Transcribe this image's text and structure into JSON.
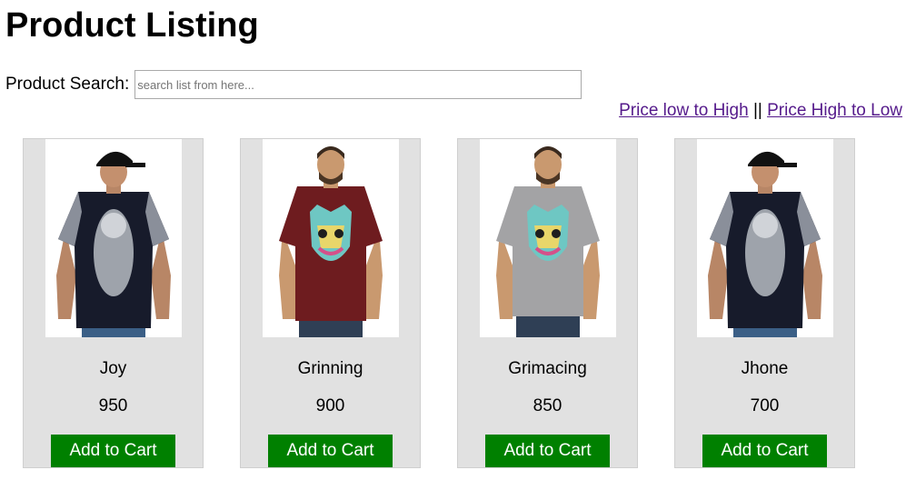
{
  "page": {
    "title": "Product Listing"
  },
  "search": {
    "label": "Product Search:",
    "placeholder": "search list from here...",
    "value": ""
  },
  "sort": {
    "low_to_high": "Price low to High",
    "separator": "||",
    "high_to_low": "Price High to Low",
    "link_color": "#551a8b"
  },
  "colors": {
    "card_background": "#e1e1e1",
    "button_background": "#008000",
    "button_text": "#ffffff"
  },
  "products": [
    {
      "name": "Joy",
      "price": "950",
      "button_label": "Add to Cart",
      "image": "black-bandana-print-tshirt-cap-model",
      "shirt_color": "#171b2b"
    },
    {
      "name": "Grinning",
      "price": "900",
      "button_label": "Add to Cart",
      "image": "maroon-cat-print-tshirt-model",
      "shirt_color": "#6e1c1f"
    },
    {
      "name": "Grimacing",
      "price": "850",
      "button_label": "Add to Cart",
      "image": "grey-cat-print-tshirt-model",
      "shirt_color": "#a3a3a5"
    },
    {
      "name": "Jhone",
      "price": "700",
      "button_label": "Add to Cart",
      "image": "black-bandana-print-tshirt-cap-model",
      "shirt_color": "#171b2b"
    }
  ]
}
